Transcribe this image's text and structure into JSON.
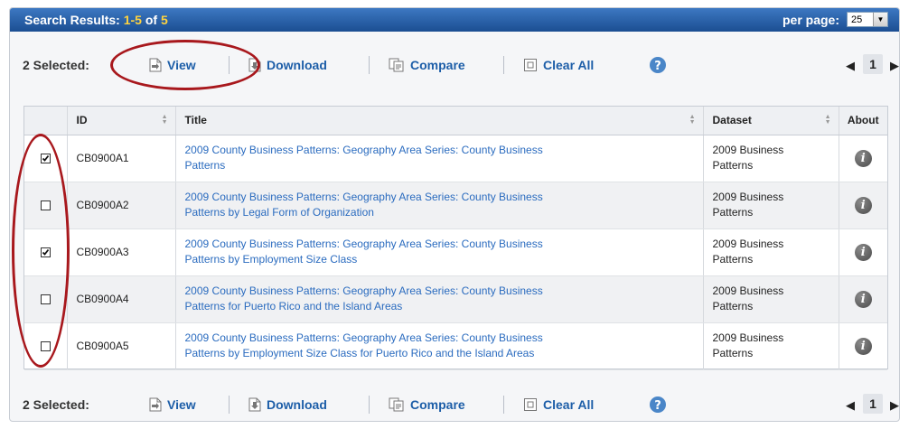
{
  "header": {
    "title": "Search Results:",
    "range": "1-5",
    "of_label": "of",
    "total": "5",
    "per_page_label": "per page:",
    "per_page_value": "25"
  },
  "toolbar": {
    "selected": "2 Selected:",
    "view": "View",
    "download": "Download",
    "compare": "Compare",
    "clear_all": "Clear All"
  },
  "pagination": {
    "current": "1"
  },
  "table": {
    "columns": [
      "ID",
      "Title",
      "Dataset",
      "About"
    ],
    "rows": [
      {
        "checked": true,
        "id": "CB0900A1",
        "title_l1": "2009 County Business Patterns: Geography Area Series: County Business",
        "title_l2": "Patterns",
        "dataset_l1": "2009 Business",
        "dataset_l2": "Patterns"
      },
      {
        "checked": false,
        "id": "CB0900A2",
        "title_l1": "2009 County Business Patterns: Geography Area Series: County Business",
        "title_l2": "Patterns by Legal Form of Organization",
        "dataset_l1": "2009 Business",
        "dataset_l2": "Patterns"
      },
      {
        "checked": true,
        "id": "CB0900A3",
        "title_l1": "2009 County Business Patterns: Geography Area Series: County Business",
        "title_l2": "Patterns by Employment Size Class",
        "dataset_l1": "2009 Business",
        "dataset_l2": "Patterns"
      },
      {
        "checked": false,
        "id": "CB0900A4",
        "title_l1": "2009 County Business Patterns: Geography Area Series: County Business",
        "title_l2": "Patterns for Puerto Rico and the Island Areas",
        "dataset_l1": "2009 Business",
        "dataset_l2": "Patterns"
      },
      {
        "checked": false,
        "id": "CB0900A5",
        "title_l1": "2009 County Business Patterns: Geography Area Series: County Business",
        "title_l2": "Patterns by Employment Size Class for Puerto Rico and the Island Areas",
        "dataset_l1": "2009 Business",
        "dataset_l2": "Patterns"
      }
    ]
  },
  "icons": {
    "view": "view-document-icon",
    "download": "download-icon",
    "compare": "compare-icon",
    "clear_all": "clear-all-icon",
    "help": "help-icon",
    "about": "info-icon"
  },
  "colors": {
    "header_blue": "#1b4e92",
    "count_yellow": "#ffd33e",
    "link_blue": "#2a6bbf",
    "annotation_red": "#a8181d"
  }
}
